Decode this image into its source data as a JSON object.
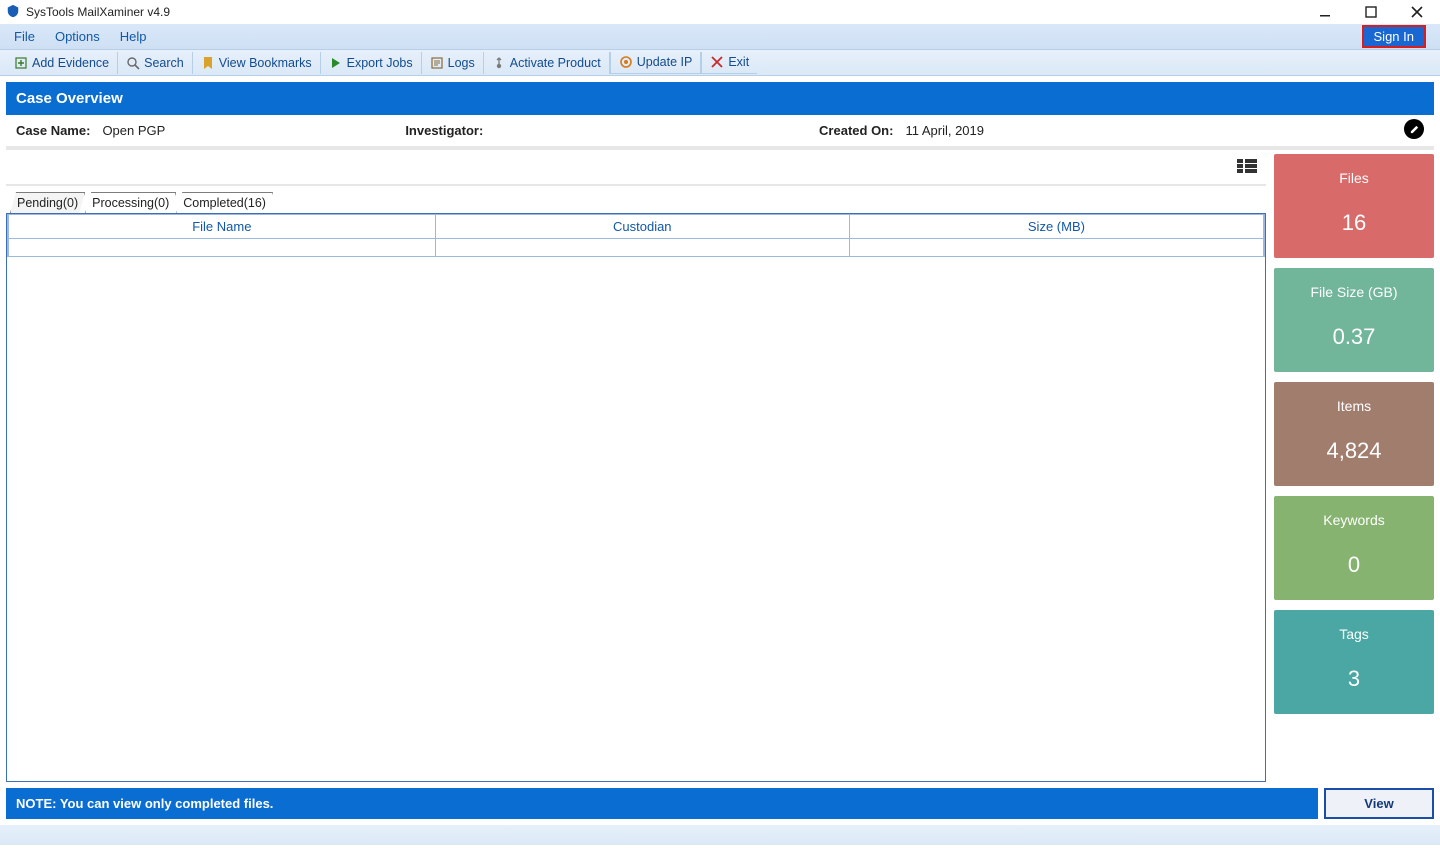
{
  "win": {
    "title": "SysTools MailXaminer v4.9"
  },
  "menu": {
    "file": "File",
    "options": "Options",
    "help": "Help",
    "signin": "Sign In"
  },
  "toolbar": {
    "add_evidence": "Add Evidence",
    "search": "Search",
    "view_bookmarks": "View Bookmarks",
    "export_jobs": "Export Jobs",
    "logs": "Logs",
    "activate": "Activate Product",
    "update_ip": "Update IP",
    "exit": "Exit"
  },
  "section_title": "Case Overview",
  "case": {
    "name_label": "Case Name:",
    "name_value": "Open PGP",
    "investigator_label": "Investigator:",
    "investigator_value": "",
    "created_label": "Created On:",
    "created_value": "11 April, 2019"
  },
  "tabs": {
    "pending": "Pending(0)",
    "processing": "Processing(0)",
    "completed": "Completed(16)"
  },
  "table": {
    "col_file": "File Name",
    "col_custodian": "Custodian",
    "col_size": "Size (MB)"
  },
  "tiles": {
    "files_label": "Files",
    "files_value": "16",
    "size_label": "File Size (GB)",
    "size_value": "0.37",
    "items_label": "Items",
    "items_value": "4,824",
    "keywords_label": "Keywords",
    "keywords_value": "0",
    "tags_label": "Tags",
    "tags_value": "3"
  },
  "note": "NOTE: You can view only completed files.",
  "view_btn": "View"
}
